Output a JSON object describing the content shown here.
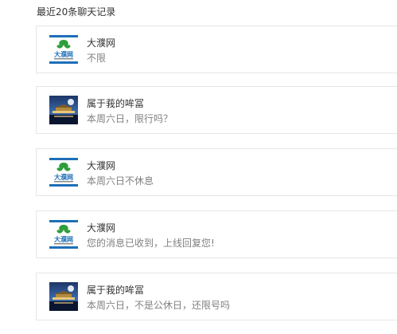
{
  "page": {
    "title": "最近20条聊天记录"
  },
  "chats": [
    {
      "avatar_type": "logo",
      "logo_text": "大濮网",
      "name": "大濮网",
      "message": "不限"
    },
    {
      "avatar_type": "photo",
      "name": "属于莪的哞冨",
      "message": "本周六日，限行吗？"
    },
    {
      "avatar_type": "logo",
      "logo_text": "大濮网",
      "name": "大濮网",
      "message": "本周六日不休息"
    },
    {
      "avatar_type": "logo",
      "logo_text": "大濮网",
      "name": "大濮网",
      "message": "您的消息已收到，上线回复您!"
    },
    {
      "avatar_type": "photo",
      "name": "属于莪的哞冨",
      "message": "本周六日，不是公休日，还限号吗"
    }
  ],
  "colors": {
    "logo_green": "#2e9e3c",
    "logo_blue": "#1e6fb8",
    "photo_sky": "#1f3f7a"
  }
}
